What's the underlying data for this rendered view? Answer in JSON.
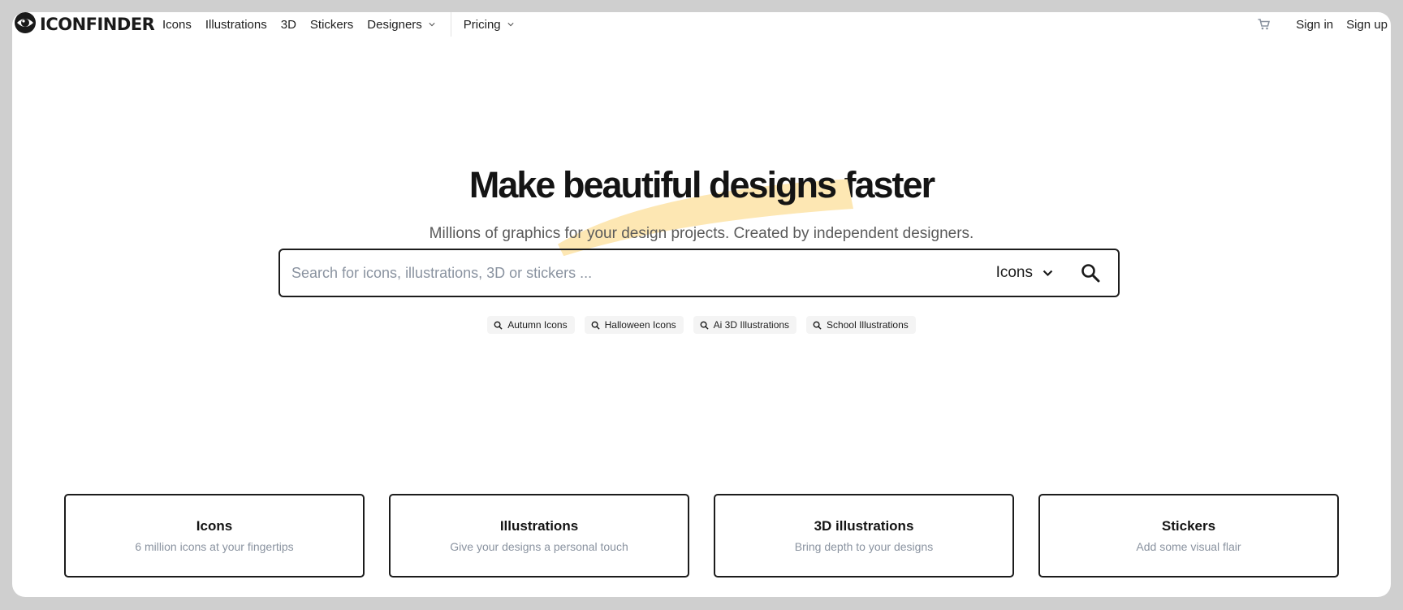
{
  "nav": {
    "brand": "ICONFINDER",
    "links": [
      {
        "label": "Icons"
      },
      {
        "label": "Illustrations"
      },
      {
        "label": "3D"
      },
      {
        "label": "Stickers"
      },
      {
        "label": "Designers",
        "dropdown": true
      }
    ],
    "pricing": "Pricing",
    "sign_in": "Sign in",
    "sign_up": "Sign up"
  },
  "hero": {
    "title_pre": "Make ",
    "title_highlight": "beautiful designs",
    "title_post": " faster",
    "subtitle": "Millions of graphics for your design projects. Created by independent designers.",
    "highlight_color": "#fde7b3"
  },
  "search": {
    "placeholder": "Search for icons, illustrations, 3D or stickers ...",
    "value": "",
    "type_selected": "Icons"
  },
  "chips": [
    "Autumn Icons",
    "Halloween Icons",
    "Ai 3D Illustrations",
    "School Illustrations"
  ],
  "cards": [
    {
      "title": "Icons",
      "subtitle": "6 million icons at your fingertips"
    },
    {
      "title": "Illustrations",
      "subtitle": "Give your designs a personal touch"
    },
    {
      "title": "3D illustrations",
      "subtitle": "Bring depth to your designs"
    },
    {
      "title": "Stickers",
      "subtitle": "Add some visual flair"
    }
  ],
  "icons": {
    "logo": "eye-logo-icon",
    "cart": "cart-icon",
    "chevron": "chevron-down-icon",
    "search": "search-icon"
  }
}
